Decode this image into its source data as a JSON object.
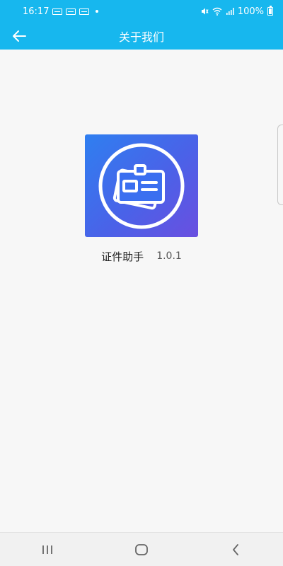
{
  "status_bar": {
    "time": "16:17",
    "battery": "100%",
    "icons": [
      "notification-icon",
      "notification-icon",
      "notification-icon",
      "dot-icon",
      "mute-icon",
      "wifi-icon",
      "signal-icon",
      "battery-icon"
    ]
  },
  "app_bar": {
    "title": "关于我们",
    "back_icon": "arrow-left-icon"
  },
  "about": {
    "app_name": "证件助手",
    "version": "1.0.1",
    "icon": "id-card-icon"
  },
  "nav_bar": {
    "icons": [
      "recent-apps-icon",
      "home-icon",
      "back-icon"
    ]
  },
  "colors": {
    "primary": "#17b7ee",
    "icon_gradient_start": "#2f7ff0",
    "icon_gradient_end": "#6a4fe0",
    "background": "#f7f7f7"
  }
}
